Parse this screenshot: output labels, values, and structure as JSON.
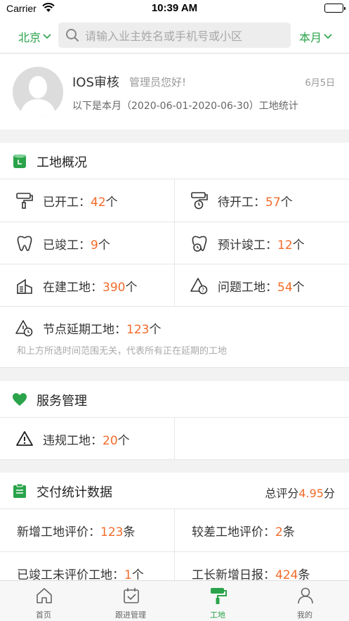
{
  "status_bar": {
    "carrier": "Carrier",
    "time": "10:39 AM"
  },
  "header": {
    "city": "北京",
    "search_placeholder": "请输入业主姓名或手机号或小区",
    "period": "本月"
  },
  "profile": {
    "name": "IOS审核",
    "greeting": "管理员您好!",
    "date": "6月5日",
    "subtitle": "以下是本月（2020-06-01-2020-06-30）工地统计"
  },
  "overview": {
    "title": "工地概况",
    "started": {
      "label": "已开工：",
      "value": "42",
      "unit": "个"
    },
    "to_start": {
      "label": "待开工：",
      "value": "57",
      "unit": "个"
    },
    "completed": {
      "label": "已竣工：",
      "value": "9",
      "unit": "个"
    },
    "expected_complete": {
      "label": "预计竣工：",
      "value": "12",
      "unit": "个"
    },
    "building": {
      "label": "在建工地：",
      "value": "390",
      "unit": "个"
    },
    "problem": {
      "label": "问题工地：",
      "value": "54",
      "unit": "个"
    },
    "delayed": {
      "label": "节点延期工地：",
      "value": "123",
      "unit": "个"
    },
    "delayed_note": "和上方所选时间范围无关，代表所有正在延期的工地"
  },
  "service": {
    "title": "服务管理",
    "violation": {
      "label": "违规工地：",
      "value": "20",
      "unit": "个"
    }
  },
  "delivery": {
    "title": "交付统计数据",
    "score_label": "总评分",
    "score_value": "4.95",
    "score_unit": "分",
    "new_reviews": {
      "label": "新增工地评价：",
      "value": "123",
      "unit": "条"
    },
    "bad_reviews": {
      "label": "较差工地评价：",
      "value": "2",
      "unit": "条"
    },
    "unreviewed": {
      "label": "已竣工未评价工地：",
      "value": "1",
      "unit": "个"
    },
    "daily_reports": {
      "label": "工长新增日报：",
      "value": "424",
      "unit": "条"
    }
  },
  "tabbar": {
    "home": "首页",
    "followup": "跟进管理",
    "site": "工地",
    "mine": "我的"
  },
  "colors": {
    "accent": "#2aa34a",
    "value": "#f26b2a"
  }
}
